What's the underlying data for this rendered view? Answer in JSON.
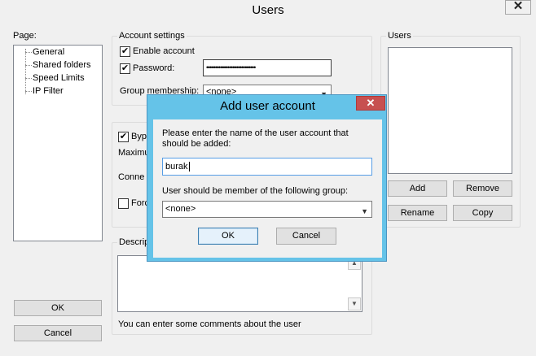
{
  "window": {
    "title": "Users",
    "close_glyph": "✕"
  },
  "page_panel": {
    "label": "Page:",
    "items": [
      "General",
      "Shared folders",
      "Speed Limits",
      "IP Filter"
    ],
    "ok_label": "OK",
    "cancel_label": "Cancel"
  },
  "account_settings": {
    "title": "Account settings",
    "enable_account": {
      "label": "Enable account",
      "checked": true
    },
    "password": {
      "label": "Password:",
      "checked": true,
      "value": "••••••••••••••••••••••••••••"
    },
    "group_membership": {
      "label": "Group membership:",
      "value": "<none>"
    }
  },
  "limits": {
    "bypass_label": "Bypa",
    "maximum_label": "Maximu",
    "connection_label": "Conne",
    "force_label": "Forc"
  },
  "description": {
    "title": "Descrip",
    "hint": "You can enter some comments about the user"
  },
  "users_panel": {
    "title": "Users",
    "add_label": "Add",
    "remove_label": "Remove",
    "rename_label": "Rename",
    "copy_label": "Copy"
  },
  "dialog": {
    "title": "Add user account",
    "close_glyph": "✕",
    "prompt": "Please enter the name of the user account that should be added:",
    "username_value": "burak",
    "group_prompt": "User should be member of the following group:",
    "group_value": "<none>",
    "ok_label": "OK",
    "cancel_label": "Cancel"
  },
  "colors": {
    "dialog_frame": "#65c3e8",
    "dialog_close": "#c75050",
    "focus_border": "#3c7fb1"
  }
}
